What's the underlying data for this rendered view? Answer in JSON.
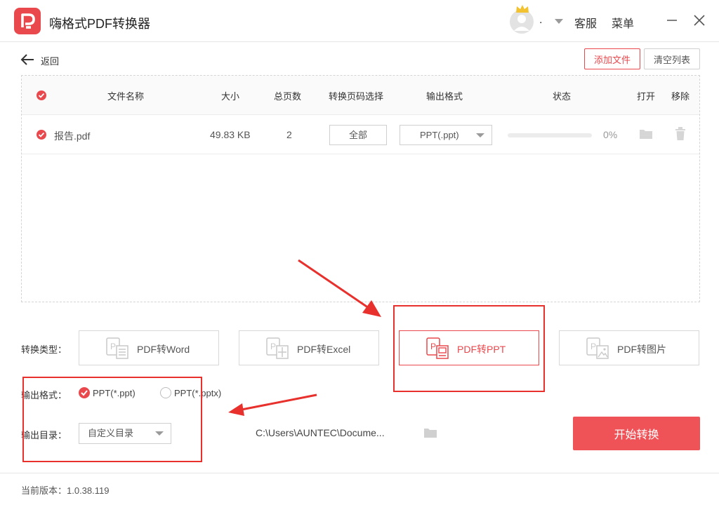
{
  "app": {
    "title": "嗨格式PDF转换器"
  },
  "user": {
    "name": "."
  },
  "header": {
    "service": "客服",
    "menu": "菜单"
  },
  "toolbar": {
    "back_label": "返回",
    "add_file": "添加文件",
    "clear_list": "清空列表"
  },
  "table": {
    "columns": {
      "name": "文件名称",
      "size": "大小",
      "pages": "总页数",
      "page_select": "转换页码选择",
      "output_format": "输出格式",
      "status": "状态",
      "open": "打开",
      "remove": "移除"
    },
    "rows": [
      {
        "name": "报告.pdf",
        "size": "49.83 KB",
        "pages": "2",
        "page_select": "全部",
        "output_format": "PPT(.ppt)",
        "progress_text": "0%",
        "progress": 0
      }
    ]
  },
  "convert_type": {
    "label": "转换类型：",
    "options": [
      "PDF转Word",
      "PDF转Excel",
      "PDF转PPT",
      "PDF转图片"
    ],
    "selected": "PDF转PPT"
  },
  "output_format": {
    "label": "输出格式：",
    "options": [
      "PPT(*.ppt)",
      "PPT(*.pptx)"
    ],
    "selected": "PPT(*.ppt)"
  },
  "output_dir": {
    "label": "输出目录：",
    "mode": "自定义目录",
    "path": "C:\\Users\\AUNTEC\\Docume..."
  },
  "start_button": "开始转换",
  "footer": {
    "version": "当前版本：1.0.38.119"
  },
  "colors": {
    "accent": "#e9484d",
    "start_button": "#ef5358",
    "annotation": "#e8302c"
  },
  "icons": [
    "app-logo",
    "crown-icon",
    "avatar",
    "minimize-icon",
    "close-icon",
    "back-arrow-icon",
    "folder-icon",
    "trash-icon",
    "pdf-to-word-icon",
    "pdf-to-excel-icon",
    "pdf-to-ppt-icon",
    "pdf-to-image-icon"
  ]
}
